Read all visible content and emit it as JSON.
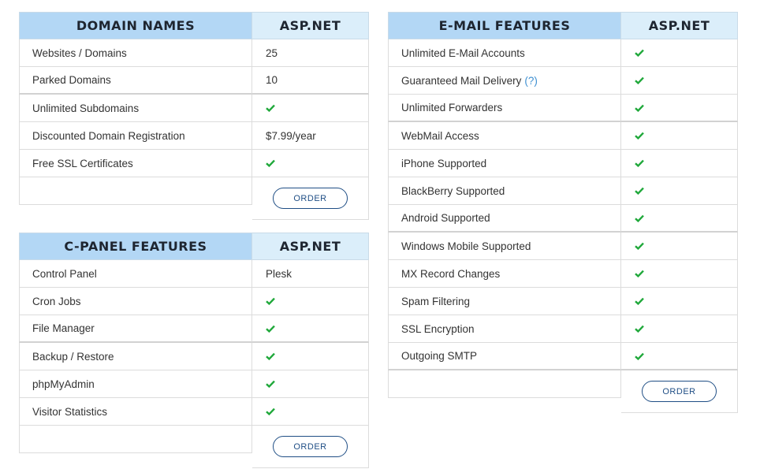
{
  "colors": {
    "header_feature_bg": "#b3d7f5",
    "header_plan_bg": "#dbeefa",
    "check_green": "#1fa83a",
    "button_border": "#1f4e85",
    "help_link": "#3d8fd1"
  },
  "domain_names": {
    "header": "DOMAIN NAMES",
    "plan": "ASP.NET",
    "rows": [
      {
        "feature": "Websites / Domains",
        "value": "25"
      },
      {
        "feature": "Parked Domains",
        "value": "10"
      },
      {
        "feature": "Unlimited Subdomains",
        "value": "check-icon"
      },
      {
        "feature": "Discounted Domain Registration",
        "value": "$7.99/year"
      },
      {
        "feature": "Free SSL Certificates",
        "value": "check-icon"
      }
    ],
    "order_label": "ORDER"
  },
  "cpanel_features": {
    "header": "C-PANEL FEATURES",
    "plan": "ASP.NET",
    "rows": [
      {
        "feature": "Control Panel",
        "value": "Plesk"
      },
      {
        "feature": "Cron Jobs",
        "value": "check-icon"
      },
      {
        "feature": "File Manager",
        "value": "check-icon"
      },
      {
        "feature": "Backup / Restore",
        "value": "check-icon"
      },
      {
        "feature": "phpMyAdmin",
        "value": "check-icon"
      },
      {
        "feature": "Visitor Statistics",
        "value": "check-icon"
      }
    ],
    "order_label": "ORDER"
  },
  "email_features": {
    "header": "E-MAIL FEATURES",
    "plan": "ASP.NET",
    "rows": [
      {
        "feature": "Unlimited E-Mail Accounts",
        "value": "check-icon"
      },
      {
        "feature": "Guaranteed Mail Delivery",
        "help": "(?)",
        "value": "check-icon"
      },
      {
        "feature": "Unlimited Forwarders",
        "value": "check-icon"
      },
      {
        "feature": "WebMail Access",
        "value": "check-icon"
      },
      {
        "feature": "iPhone Supported",
        "value": "check-icon"
      },
      {
        "feature": "BlackBerry Supported",
        "value": "check-icon"
      },
      {
        "feature": "Android Supported",
        "value": "check-icon"
      },
      {
        "feature": "Windows Mobile Supported",
        "value": "check-icon"
      },
      {
        "feature": "MX Record Changes",
        "value": "check-icon"
      },
      {
        "feature": "Spam Filtering",
        "value": "check-icon"
      },
      {
        "feature": "SSL Encryption",
        "value": "check-icon"
      },
      {
        "feature": "Outgoing SMTP",
        "value": "check-icon"
      }
    ],
    "order_label": "ORDER"
  }
}
